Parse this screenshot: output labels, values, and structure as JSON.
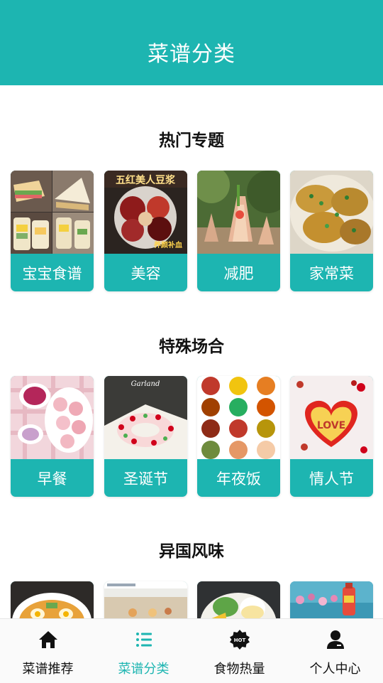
{
  "header": {
    "title": "菜谱分类"
  },
  "sections": [
    {
      "title": "热门专题",
      "cards": [
        {
          "label": "宝宝食谱",
          "icon": "sandwich-photo"
        },
        {
          "label": "美容",
          "icon": "red-beans-photo",
          "photo_caption": "五红美人豆浆",
          "photo_subcaption": "养颜补血"
        },
        {
          "label": "减肥",
          "icon": "vegetable-rolls-photo"
        },
        {
          "label": "家常菜",
          "icon": "braised-fish-photo"
        }
      ]
    },
    {
      "title": "特殊场合",
      "cards": [
        {
          "label": "早餐",
          "icon": "rose-buns-photo"
        },
        {
          "label": "圣诞节",
          "icon": "christmas-wreath-cake-photo",
          "photo_caption": "Garland"
        },
        {
          "label": "年夜饭",
          "icon": "dish-collage-photo"
        },
        {
          "label": "情人节",
          "icon": "love-pizza-photo",
          "photo_caption": "LOVE"
        }
      ]
    },
    {
      "title": "异国风味",
      "cards": [
        {
          "label": "",
          "icon": "ramen-bowl-photo"
        },
        {
          "label": "",
          "icon": "table-setting-photo"
        },
        {
          "label": "",
          "icon": "breakfast-plate-photo"
        },
        {
          "label": "",
          "icon": "flower-bottle-photo"
        }
      ]
    }
  ],
  "tabbar": {
    "active": "菜谱分类",
    "active_color": "#1db5b1",
    "items": [
      {
        "label": "菜谱推荐",
        "icon": "home-icon"
      },
      {
        "label": "菜谱分类",
        "icon": "list-icon"
      },
      {
        "label": "食物热量",
        "icon": "hot-badge-icon",
        "badge_text": "HOT"
      },
      {
        "label": "个人中心",
        "icon": "user-icon"
      }
    ]
  },
  "colors": {
    "accent": "#1db5b1",
    "text": "#111111",
    "tab_background": "#fafafa"
  }
}
